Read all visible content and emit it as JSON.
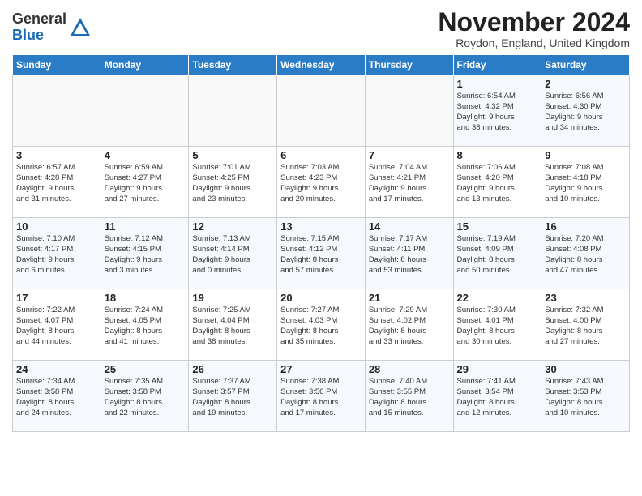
{
  "logo": {
    "line1": "General",
    "line2": "Blue"
  },
  "title": "November 2024",
  "location": "Roydon, England, United Kingdom",
  "weekdays": [
    "Sunday",
    "Monday",
    "Tuesday",
    "Wednesday",
    "Thursday",
    "Friday",
    "Saturday"
  ],
  "weeks": [
    [
      {
        "day": "",
        "detail": ""
      },
      {
        "day": "",
        "detail": ""
      },
      {
        "day": "",
        "detail": ""
      },
      {
        "day": "",
        "detail": ""
      },
      {
        "day": "",
        "detail": ""
      },
      {
        "day": "1",
        "detail": "Sunrise: 6:54 AM\nSunset: 4:32 PM\nDaylight: 9 hours\nand 38 minutes."
      },
      {
        "day": "2",
        "detail": "Sunrise: 6:56 AM\nSunset: 4:30 PM\nDaylight: 9 hours\nand 34 minutes."
      }
    ],
    [
      {
        "day": "3",
        "detail": "Sunrise: 6:57 AM\nSunset: 4:28 PM\nDaylight: 9 hours\nand 31 minutes."
      },
      {
        "day": "4",
        "detail": "Sunrise: 6:59 AM\nSunset: 4:27 PM\nDaylight: 9 hours\nand 27 minutes."
      },
      {
        "day": "5",
        "detail": "Sunrise: 7:01 AM\nSunset: 4:25 PM\nDaylight: 9 hours\nand 23 minutes."
      },
      {
        "day": "6",
        "detail": "Sunrise: 7:03 AM\nSunset: 4:23 PM\nDaylight: 9 hours\nand 20 minutes."
      },
      {
        "day": "7",
        "detail": "Sunrise: 7:04 AM\nSunset: 4:21 PM\nDaylight: 9 hours\nand 17 minutes."
      },
      {
        "day": "8",
        "detail": "Sunrise: 7:06 AM\nSunset: 4:20 PM\nDaylight: 9 hours\nand 13 minutes."
      },
      {
        "day": "9",
        "detail": "Sunrise: 7:08 AM\nSunset: 4:18 PM\nDaylight: 9 hours\nand 10 minutes."
      }
    ],
    [
      {
        "day": "10",
        "detail": "Sunrise: 7:10 AM\nSunset: 4:17 PM\nDaylight: 9 hours\nand 6 minutes."
      },
      {
        "day": "11",
        "detail": "Sunrise: 7:12 AM\nSunset: 4:15 PM\nDaylight: 9 hours\nand 3 minutes."
      },
      {
        "day": "12",
        "detail": "Sunrise: 7:13 AM\nSunset: 4:14 PM\nDaylight: 9 hours\nand 0 minutes."
      },
      {
        "day": "13",
        "detail": "Sunrise: 7:15 AM\nSunset: 4:12 PM\nDaylight: 8 hours\nand 57 minutes."
      },
      {
        "day": "14",
        "detail": "Sunrise: 7:17 AM\nSunset: 4:11 PM\nDaylight: 8 hours\nand 53 minutes."
      },
      {
        "day": "15",
        "detail": "Sunrise: 7:19 AM\nSunset: 4:09 PM\nDaylight: 8 hours\nand 50 minutes."
      },
      {
        "day": "16",
        "detail": "Sunrise: 7:20 AM\nSunset: 4:08 PM\nDaylight: 8 hours\nand 47 minutes."
      }
    ],
    [
      {
        "day": "17",
        "detail": "Sunrise: 7:22 AM\nSunset: 4:07 PM\nDaylight: 8 hours\nand 44 minutes."
      },
      {
        "day": "18",
        "detail": "Sunrise: 7:24 AM\nSunset: 4:05 PM\nDaylight: 8 hours\nand 41 minutes."
      },
      {
        "day": "19",
        "detail": "Sunrise: 7:25 AM\nSunset: 4:04 PM\nDaylight: 8 hours\nand 38 minutes."
      },
      {
        "day": "20",
        "detail": "Sunrise: 7:27 AM\nSunset: 4:03 PM\nDaylight: 8 hours\nand 35 minutes."
      },
      {
        "day": "21",
        "detail": "Sunrise: 7:29 AM\nSunset: 4:02 PM\nDaylight: 8 hours\nand 33 minutes."
      },
      {
        "day": "22",
        "detail": "Sunrise: 7:30 AM\nSunset: 4:01 PM\nDaylight: 8 hours\nand 30 minutes."
      },
      {
        "day": "23",
        "detail": "Sunrise: 7:32 AM\nSunset: 4:00 PM\nDaylight: 8 hours\nand 27 minutes."
      }
    ],
    [
      {
        "day": "24",
        "detail": "Sunrise: 7:34 AM\nSunset: 3:58 PM\nDaylight: 8 hours\nand 24 minutes."
      },
      {
        "day": "25",
        "detail": "Sunrise: 7:35 AM\nSunset: 3:58 PM\nDaylight: 8 hours\nand 22 minutes."
      },
      {
        "day": "26",
        "detail": "Sunrise: 7:37 AM\nSunset: 3:57 PM\nDaylight: 8 hours\nand 19 minutes."
      },
      {
        "day": "27",
        "detail": "Sunrise: 7:38 AM\nSunset: 3:56 PM\nDaylight: 8 hours\nand 17 minutes."
      },
      {
        "day": "28",
        "detail": "Sunrise: 7:40 AM\nSunset: 3:55 PM\nDaylight: 8 hours\nand 15 minutes."
      },
      {
        "day": "29",
        "detail": "Sunrise: 7:41 AM\nSunset: 3:54 PM\nDaylight: 8 hours\nand 12 minutes."
      },
      {
        "day": "30",
        "detail": "Sunrise: 7:43 AM\nSunset: 3:53 PM\nDaylight: 8 hours\nand 10 minutes."
      }
    ]
  ]
}
